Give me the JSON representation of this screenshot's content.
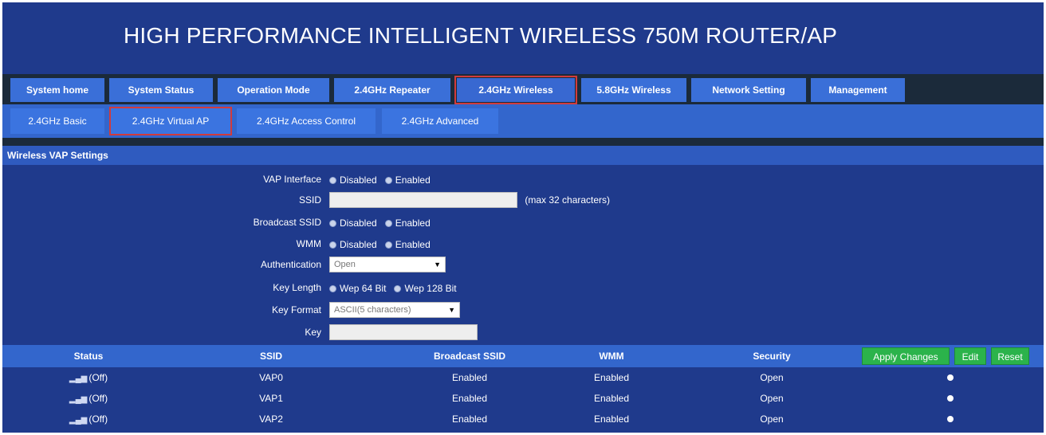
{
  "header": {
    "title": "HIGH PERFORMANCE INTELLIGENT WIRELESS 750M ROUTER/AP"
  },
  "main_tabs": [
    {
      "label": "System home"
    },
    {
      "label": "System Status"
    },
    {
      "label": "Operation Mode"
    },
    {
      "label": "2.4GHz Repeater"
    },
    {
      "label": "2.4GHz Wireless",
      "active": true
    },
    {
      "label": "5.8GHz Wireless"
    },
    {
      "label": "Network Setting"
    },
    {
      "label": "Management"
    }
  ],
  "sub_tabs": [
    {
      "label": "2.4GHz Basic"
    },
    {
      "label": "2.4GHz Virtual AP",
      "active": true
    },
    {
      "label": "2.4GHz Access Control"
    },
    {
      "label": "2.4GHz Advanced"
    }
  ],
  "section": {
    "title": "Wireless VAP Settings"
  },
  "form": {
    "vap_interface": {
      "label": "VAP Interface",
      "options": [
        "Disabled",
        "Enabled"
      ]
    },
    "ssid": {
      "label": "SSID",
      "value": "",
      "hint": "(max 32 characters)"
    },
    "broadcast_ssid": {
      "label": "Broadcast SSID",
      "options": [
        "Disabled",
        "Enabled"
      ]
    },
    "wmm": {
      "label": "WMM",
      "options": [
        "Disabled",
        "Enabled"
      ]
    },
    "authentication": {
      "label": "Authentication",
      "selected": "Open"
    },
    "key_length": {
      "label": "Key Length",
      "options": [
        "Wep 64 Bit",
        "Wep 128 Bit"
      ]
    },
    "key_format": {
      "label": "Key Format",
      "selected": "ASCII(5 characters)"
    },
    "key": {
      "label": "Key",
      "value": ""
    }
  },
  "table": {
    "headers": {
      "status": "Status",
      "ssid": "SSID",
      "broadcast": "Broadcast SSID",
      "wmm": "WMM",
      "security": "Security"
    },
    "buttons": {
      "apply": "Apply Changes",
      "edit": "Edit",
      "reset": "Reset"
    },
    "rows": [
      {
        "status": "(Off)",
        "ssid": "VAP0",
        "broadcast": "Enabled",
        "wmm": "Enabled",
        "security": "Open"
      },
      {
        "status": "(Off)",
        "ssid": "VAP1",
        "broadcast": "Enabled",
        "wmm": "Enabled",
        "security": "Open"
      },
      {
        "status": "(Off)",
        "ssid": "VAP2",
        "broadcast": "Enabled",
        "wmm": "Enabled",
        "security": "Open"
      }
    ]
  },
  "colors": {
    "background": "#1f3a8c",
    "tab": "#3a6fd8",
    "subtab_bar": "#3366cc",
    "active_outline": "#d23b3b",
    "button": "#2bb34b"
  }
}
